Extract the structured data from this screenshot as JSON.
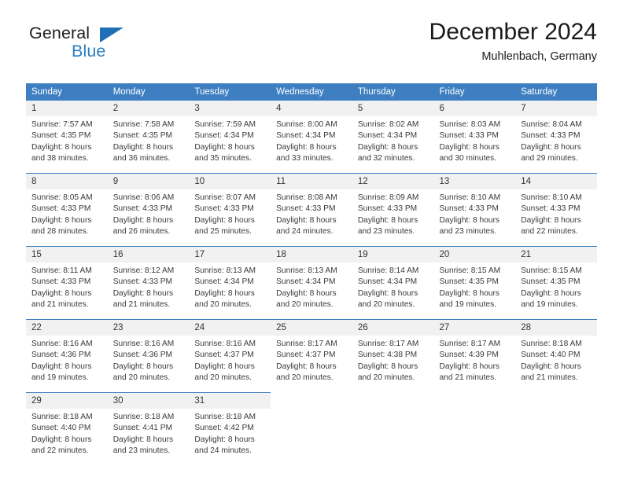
{
  "brand": {
    "name_top": "General",
    "name_bottom": "Blue",
    "triangle_color": "#1f6fb6",
    "blue_text_color": "#2a7fc4"
  },
  "header": {
    "title": "December 2024",
    "subtitle": "Muhlenbach, Germany"
  },
  "theme": {
    "header_bg": "#3d7fc1",
    "header_text": "#ffffff",
    "daynum_bg": "#f1f1f1",
    "week_rule": "#3d7fc1",
    "body_text": "#3a3a3a"
  },
  "weekday_headers": [
    "Sunday",
    "Monday",
    "Tuesday",
    "Wednesday",
    "Thursday",
    "Friday",
    "Saturday"
  ],
  "weeks": [
    [
      {
        "day": "1",
        "sunrise": "Sunrise: 7:57 AM",
        "sunset": "Sunset: 4:35 PM",
        "daylight1": "Daylight: 8 hours",
        "daylight2": "and 38 minutes."
      },
      {
        "day": "2",
        "sunrise": "Sunrise: 7:58 AM",
        "sunset": "Sunset: 4:35 PM",
        "daylight1": "Daylight: 8 hours",
        "daylight2": "and 36 minutes."
      },
      {
        "day": "3",
        "sunrise": "Sunrise: 7:59 AM",
        "sunset": "Sunset: 4:34 PM",
        "daylight1": "Daylight: 8 hours",
        "daylight2": "and 35 minutes."
      },
      {
        "day": "4",
        "sunrise": "Sunrise: 8:00 AM",
        "sunset": "Sunset: 4:34 PM",
        "daylight1": "Daylight: 8 hours",
        "daylight2": "and 33 minutes."
      },
      {
        "day": "5",
        "sunrise": "Sunrise: 8:02 AM",
        "sunset": "Sunset: 4:34 PM",
        "daylight1": "Daylight: 8 hours",
        "daylight2": "and 32 minutes."
      },
      {
        "day": "6",
        "sunrise": "Sunrise: 8:03 AM",
        "sunset": "Sunset: 4:33 PM",
        "daylight1": "Daylight: 8 hours",
        "daylight2": "and 30 minutes."
      },
      {
        "day": "7",
        "sunrise": "Sunrise: 8:04 AM",
        "sunset": "Sunset: 4:33 PM",
        "daylight1": "Daylight: 8 hours",
        "daylight2": "and 29 minutes."
      }
    ],
    [
      {
        "day": "8",
        "sunrise": "Sunrise: 8:05 AM",
        "sunset": "Sunset: 4:33 PM",
        "daylight1": "Daylight: 8 hours",
        "daylight2": "and 28 minutes."
      },
      {
        "day": "9",
        "sunrise": "Sunrise: 8:06 AM",
        "sunset": "Sunset: 4:33 PM",
        "daylight1": "Daylight: 8 hours",
        "daylight2": "and 26 minutes."
      },
      {
        "day": "10",
        "sunrise": "Sunrise: 8:07 AM",
        "sunset": "Sunset: 4:33 PM",
        "daylight1": "Daylight: 8 hours",
        "daylight2": "and 25 minutes."
      },
      {
        "day": "11",
        "sunrise": "Sunrise: 8:08 AM",
        "sunset": "Sunset: 4:33 PM",
        "daylight1": "Daylight: 8 hours",
        "daylight2": "and 24 minutes."
      },
      {
        "day": "12",
        "sunrise": "Sunrise: 8:09 AM",
        "sunset": "Sunset: 4:33 PM",
        "daylight1": "Daylight: 8 hours",
        "daylight2": "and 23 minutes."
      },
      {
        "day": "13",
        "sunrise": "Sunrise: 8:10 AM",
        "sunset": "Sunset: 4:33 PM",
        "daylight1": "Daylight: 8 hours",
        "daylight2": "and 23 minutes."
      },
      {
        "day": "14",
        "sunrise": "Sunrise: 8:10 AM",
        "sunset": "Sunset: 4:33 PM",
        "daylight1": "Daylight: 8 hours",
        "daylight2": "and 22 minutes."
      }
    ],
    [
      {
        "day": "15",
        "sunrise": "Sunrise: 8:11 AM",
        "sunset": "Sunset: 4:33 PM",
        "daylight1": "Daylight: 8 hours",
        "daylight2": "and 21 minutes."
      },
      {
        "day": "16",
        "sunrise": "Sunrise: 8:12 AM",
        "sunset": "Sunset: 4:33 PM",
        "daylight1": "Daylight: 8 hours",
        "daylight2": "and 21 minutes."
      },
      {
        "day": "17",
        "sunrise": "Sunrise: 8:13 AM",
        "sunset": "Sunset: 4:34 PM",
        "daylight1": "Daylight: 8 hours",
        "daylight2": "and 20 minutes."
      },
      {
        "day": "18",
        "sunrise": "Sunrise: 8:13 AM",
        "sunset": "Sunset: 4:34 PM",
        "daylight1": "Daylight: 8 hours",
        "daylight2": "and 20 minutes."
      },
      {
        "day": "19",
        "sunrise": "Sunrise: 8:14 AM",
        "sunset": "Sunset: 4:34 PM",
        "daylight1": "Daylight: 8 hours",
        "daylight2": "and 20 minutes."
      },
      {
        "day": "20",
        "sunrise": "Sunrise: 8:15 AM",
        "sunset": "Sunset: 4:35 PM",
        "daylight1": "Daylight: 8 hours",
        "daylight2": "and 19 minutes."
      },
      {
        "day": "21",
        "sunrise": "Sunrise: 8:15 AM",
        "sunset": "Sunset: 4:35 PM",
        "daylight1": "Daylight: 8 hours",
        "daylight2": "and 19 minutes."
      }
    ],
    [
      {
        "day": "22",
        "sunrise": "Sunrise: 8:16 AM",
        "sunset": "Sunset: 4:36 PM",
        "daylight1": "Daylight: 8 hours",
        "daylight2": "and 19 minutes."
      },
      {
        "day": "23",
        "sunrise": "Sunrise: 8:16 AM",
        "sunset": "Sunset: 4:36 PM",
        "daylight1": "Daylight: 8 hours",
        "daylight2": "and 20 minutes."
      },
      {
        "day": "24",
        "sunrise": "Sunrise: 8:16 AM",
        "sunset": "Sunset: 4:37 PM",
        "daylight1": "Daylight: 8 hours",
        "daylight2": "and 20 minutes."
      },
      {
        "day": "25",
        "sunrise": "Sunrise: 8:17 AM",
        "sunset": "Sunset: 4:37 PM",
        "daylight1": "Daylight: 8 hours",
        "daylight2": "and 20 minutes."
      },
      {
        "day": "26",
        "sunrise": "Sunrise: 8:17 AM",
        "sunset": "Sunset: 4:38 PM",
        "daylight1": "Daylight: 8 hours",
        "daylight2": "and 20 minutes."
      },
      {
        "day": "27",
        "sunrise": "Sunrise: 8:17 AM",
        "sunset": "Sunset: 4:39 PM",
        "daylight1": "Daylight: 8 hours",
        "daylight2": "and 21 minutes."
      },
      {
        "day": "28",
        "sunrise": "Sunrise: 8:18 AM",
        "sunset": "Sunset: 4:40 PM",
        "daylight1": "Daylight: 8 hours",
        "daylight2": "and 21 minutes."
      }
    ],
    [
      {
        "day": "29",
        "sunrise": "Sunrise: 8:18 AM",
        "sunset": "Sunset: 4:40 PM",
        "daylight1": "Daylight: 8 hours",
        "daylight2": "and 22 minutes."
      },
      {
        "day": "30",
        "sunrise": "Sunrise: 8:18 AM",
        "sunset": "Sunset: 4:41 PM",
        "daylight1": "Daylight: 8 hours",
        "daylight2": "and 23 minutes."
      },
      {
        "day": "31",
        "sunrise": "Sunrise: 8:18 AM",
        "sunset": "Sunset: 4:42 PM",
        "daylight1": "Daylight: 8 hours",
        "daylight2": "and 24 minutes."
      },
      {
        "day": "",
        "sunrise": "",
        "sunset": "",
        "daylight1": "",
        "daylight2": ""
      },
      {
        "day": "",
        "sunrise": "",
        "sunset": "",
        "daylight1": "",
        "daylight2": ""
      },
      {
        "day": "",
        "sunrise": "",
        "sunset": "",
        "daylight1": "",
        "daylight2": ""
      },
      {
        "day": "",
        "sunrise": "",
        "sunset": "",
        "daylight1": "",
        "daylight2": ""
      }
    ]
  ]
}
